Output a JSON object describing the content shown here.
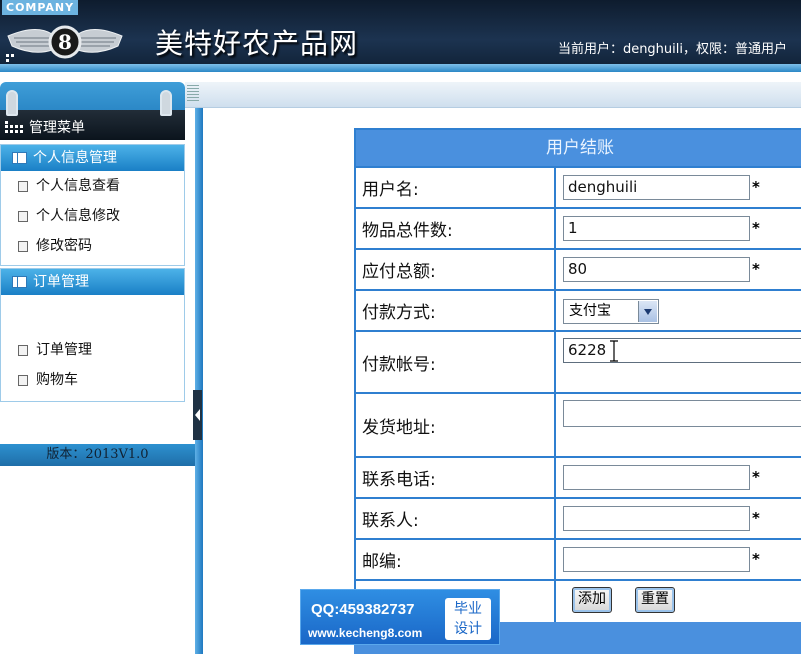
{
  "header": {
    "company": "COMPANY",
    "logo_text": "8",
    "site_title": "美特好农产品网",
    "user_info": "当前用户：denghuili，权限：普通用户"
  },
  "sidebar": {
    "menu_title": "管理菜单",
    "groups": [
      {
        "title": "个人信息管理",
        "items": [
          "个人信息查看",
          "个人信息修改",
          "修改密码"
        ]
      },
      {
        "title": "订单管理",
        "items": [
          "订单管理",
          "购物车"
        ]
      }
    ],
    "version": "版本：2013V1.0"
  },
  "form": {
    "title": "用户结账",
    "required_mark": "*",
    "fields": {
      "username": {
        "label": "用户名:",
        "value": "denghuili"
      },
      "total_items": {
        "label": "物品总件数:",
        "value": "1"
      },
      "total_amount": {
        "label": "应付总额:",
        "value": "80"
      },
      "payment_method": {
        "label": "付款方式:",
        "value": "支付宝"
      },
      "account_no": {
        "label": "付款帐号:",
        "value": "6228"
      },
      "address": {
        "label": "发货地址:",
        "value": ""
      },
      "phone": {
        "label": "联系电话:",
        "value": ""
      },
      "contact": {
        "label": "联系人:",
        "value": ""
      },
      "postcode": {
        "label": "邮编:",
        "value": ""
      }
    },
    "buttons": {
      "add": "添加",
      "reset": "重置"
    }
  },
  "watermark": {
    "qq": "QQ:459382737",
    "url": "www.kecheng8.com",
    "badge_line1": "毕业",
    "badge_line2": "设计"
  },
  "colors": {
    "accent_blue": "#4a90de",
    "header_dark": "#1c3350",
    "sidebar_blue": "#1f7fc6"
  }
}
